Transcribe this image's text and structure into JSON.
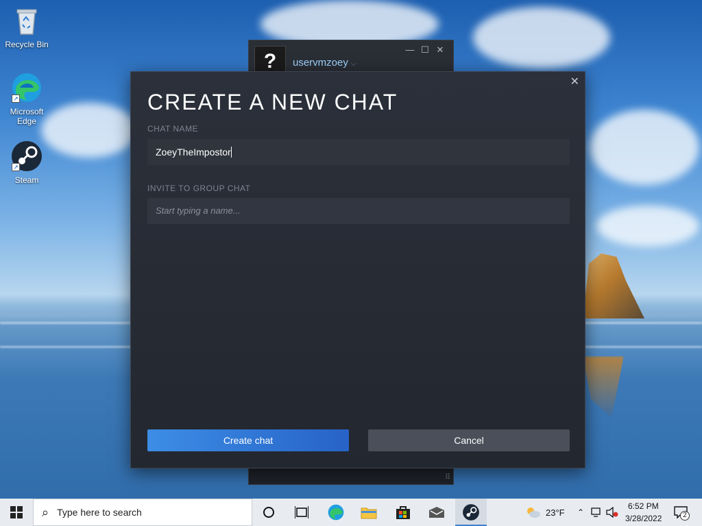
{
  "desktop": {
    "icons": [
      {
        "label": "Recycle Bin",
        "icon": "recycle-bin-icon"
      },
      {
        "label": "Microsoft Edge",
        "icon": "edge-icon"
      },
      {
        "label": "Steam",
        "icon": "steam-icon"
      }
    ]
  },
  "background_window": {
    "avatar_glyph": "?",
    "username": "uservmzoey",
    "caret": "⌵",
    "minimize": "—",
    "maximize": "☐",
    "close": "✕",
    "grip": "⠿"
  },
  "dialog": {
    "title": "CREATE A NEW CHAT",
    "close_glyph": "✕",
    "chat_name_label": "CHAT NAME",
    "chat_name_value": "ZoeyTheImpostor",
    "invite_label": "INVITE TO GROUP CHAT",
    "invite_placeholder": "Start typing a name...",
    "create_button": "Create chat",
    "cancel_button": "Cancel"
  },
  "taskbar": {
    "search_placeholder": "Type here to search",
    "weather": "23°F",
    "time": "6:52 PM",
    "date": "3/28/2022",
    "notification_count": "2"
  },
  "colors": {
    "accent_blue": "#3c8de5",
    "dialog_bg": "#2b303a",
    "username_color": "#9fd3ff"
  }
}
